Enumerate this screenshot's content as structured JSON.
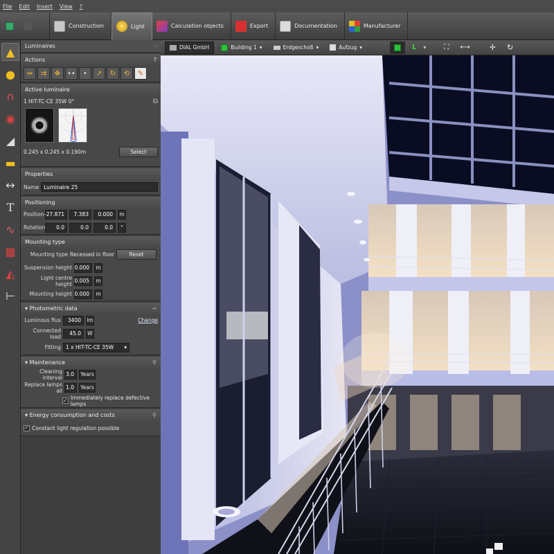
{
  "menu": [
    "File",
    "Edit",
    "Insert",
    "View",
    "?"
  ],
  "ribbon": {
    "tabs": [
      {
        "label": "Construction",
        "icon": "construction-icon",
        "active": false
      },
      {
        "label": "Light",
        "icon": "light-icon",
        "active": true
      },
      {
        "label": "Calculation objects",
        "icon": "calculation-icon",
        "active": false
      },
      {
        "label": "Export",
        "icon": "export-icon",
        "active": false
      },
      {
        "label": "Documentation",
        "icon": "documentation-icon",
        "active": false
      },
      {
        "label": "Manufacturer",
        "icon": "manufacturer-icon",
        "active": false
      }
    ]
  },
  "panel": {
    "title": "Luminaires",
    "actions": {
      "title": "Actions",
      "help": "?"
    },
    "active": {
      "title": "Active luminaire",
      "name": "1 HIT-TC-CE 35W 0°",
      "dims": "0.245 x 0.245 x 0.190m",
      "select_label": "Select"
    },
    "properties": {
      "title": "Properties",
      "name_label": "Name",
      "name_value": "Luminaire 25"
    },
    "positioning": {
      "title": "Positioning",
      "position_label": "Position",
      "position": [
        "-27.871",
        "7.383",
        "0.000"
      ],
      "position_unit": "m",
      "rotation_label": "Rotation",
      "rotation": [
        "0.0",
        "0.0",
        "0.0"
      ],
      "rotation_unit": "°"
    },
    "mounting": {
      "title": "Mounting type",
      "type_label": "Mounting type",
      "type_value": "Recessed in floor",
      "reset_label": "Reset",
      "susp_label": "Suspension height",
      "susp_value": "0.000",
      "centre_label": "Light centre height",
      "centre_value": "0.005",
      "mount_label": "Mounting height",
      "mount_value": "0.000",
      "unit": "m"
    },
    "photometric": {
      "title": "Photometric data",
      "flux_label": "Luminous flux",
      "flux_value": "3400",
      "flux_unit": "lm",
      "change_label": "Change",
      "load_label": "Connected load",
      "load_value": "45.0",
      "load_unit": "W",
      "fitting_label": "Fitting",
      "fitting_value": "1 x HIT-TC-CE  35W"
    },
    "maintenance": {
      "title": "Maintenance",
      "clean_label": "Cleaning interval",
      "clean_value": "3.0",
      "clean_unit": "Years",
      "replace_label": "Replace lamps all",
      "replace_value": "1.0",
      "replace_unit": "Years",
      "immediate_label": "Immediately replace defective lamps"
    },
    "energy": {
      "title": "Energy consumption and costs",
      "constant_label": "Constant light regulation possible"
    }
  },
  "viewport": {
    "tabs": [
      {
        "label": "DIAL GmbH",
        "active": true
      },
      {
        "label": "Building 1",
        "active": false
      },
      {
        "label": "Erdgeschoß",
        "active": false
      },
      {
        "label": "Aufzug",
        "active": false
      }
    ]
  }
}
